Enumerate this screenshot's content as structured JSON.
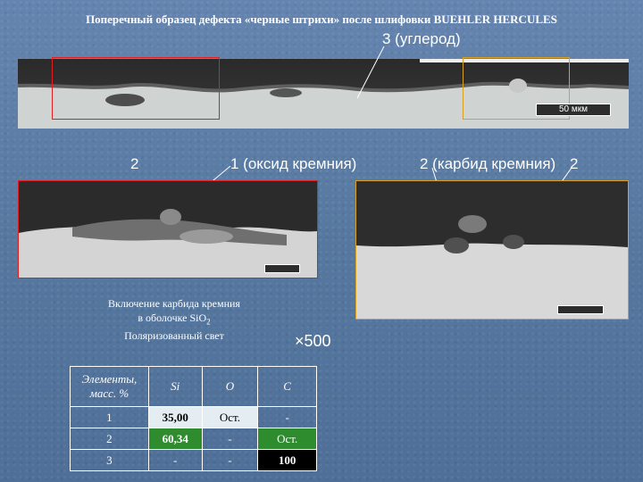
{
  "title": "Поперечный образец дефекта «черные штрихи» после шлифовки BUEHLER HERCULES",
  "labels": {
    "carbon": "3 (углерод)",
    "two_left": "2",
    "oxide": "1 (оксид кремния)",
    "carbide": "2 (карбид кремния)",
    "two_right": "2",
    "magnification": "×500",
    "scale_top": "50 мкм"
  },
  "caption": {
    "line1": "Включение карбида кремния",
    "line2": "в оболочке SiO",
    "line2_sub": "2",
    "line3": "Поляризованный свет"
  },
  "table": {
    "header": [
      "Элементы, масс. %",
      "Si",
      "O",
      "C"
    ],
    "rows": [
      {
        "n": "1",
        "si": "35,00",
        "o": "Ост.",
        "c": "-"
      },
      {
        "n": "2",
        "si": "60,34",
        "o": "-",
        "c": "Ост."
      },
      {
        "n": "3",
        "si": "-",
        "o": "-",
        "c": "100"
      }
    ]
  },
  "colors": {
    "red_frame": "#e02020",
    "orange_frame": "#d8a020",
    "cell_highlight_light": "#e4eef2",
    "cell_highlight_green": "#2e8b2e",
    "cell_highlight_black": "#000000"
  }
}
